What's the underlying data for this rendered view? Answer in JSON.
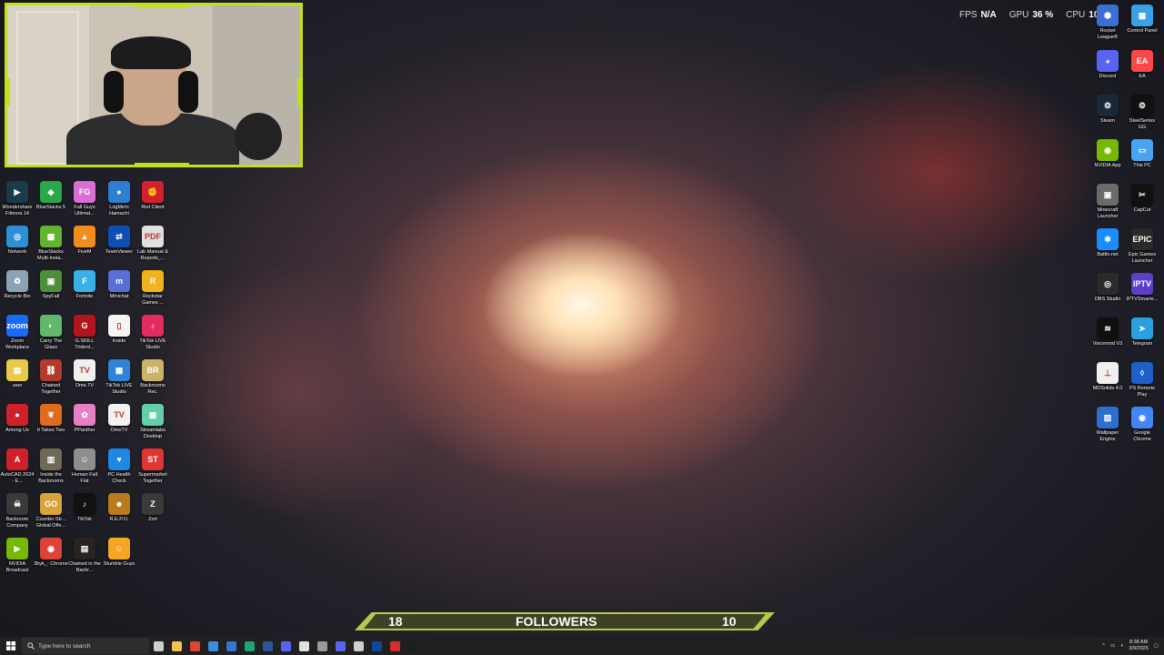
{
  "stats": {
    "fps_label": "FPS",
    "fps_value": "N/A",
    "gpu_label": "GPU",
    "gpu_value": "36 %",
    "cpu_label": "CPU",
    "cpu_value": "10"
  },
  "followers": {
    "label": "FOLLOWERS",
    "current": "18",
    "goal": "10"
  },
  "desktop_left": [
    {
      "label": "Wondershare Filmora 14",
      "color": "#1c3b4a",
      "glyph": "▶"
    },
    {
      "label": "BlueStacks 5",
      "color": "#2aa84a",
      "glyph": "◆"
    },
    {
      "label": "Fall Guys Ultimat...",
      "color": "#d86fd2",
      "glyph": "FG"
    },
    {
      "label": "LogMeIn Hamachi",
      "color": "#2f7fd0",
      "glyph": "●"
    },
    {
      "label": "Riot Client",
      "color": "#d4202e",
      "glyph": "✊"
    },
    {
      "label": "Network",
      "color": "#2e8fd6",
      "glyph": "◎"
    },
    {
      "label": "BlueStacks Multi-Insta...",
      "color": "#62b32e",
      "glyph": "▦"
    },
    {
      "label": "FiveM",
      "color": "#f28c1c",
      "glyph": "▲"
    },
    {
      "label": "TeamViewer",
      "color": "#0e4fb3",
      "glyph": "⇄"
    },
    {
      "label": "Lab Manual & Reports_...",
      "color": "#e0e0e0",
      "glyph": "PDF"
    },
    {
      "label": "Recycle Bin",
      "color": "#8aa3b5",
      "glyph": "♻"
    },
    {
      "label": "SpyFall",
      "color": "#4f8f3a",
      "glyph": "▣"
    },
    {
      "label": "Fortnite",
      "color": "#3ab0e8",
      "glyph": "F"
    },
    {
      "label": "Minichat",
      "color": "#5a6fd6",
      "glyph": "m"
    },
    {
      "label": "Rockstar Games ...",
      "color": "#f2b21c",
      "glyph": "R"
    },
    {
      "label": "Zoom Workplace",
      "color": "#1b6af5",
      "glyph": "zoom"
    },
    {
      "label": "Carry The Glass",
      "color": "#5fb86b",
      "glyph": "◐"
    },
    {
      "label": "G.SKILL Trident...",
      "color": "#b3151d",
      "glyph": "G"
    },
    {
      "label": "Inside",
      "color": "#f4f4f4",
      "glyph": "▯"
    },
    {
      "label": "TikTok LIVE Studio",
      "color": "#e22b5e",
      "glyph": "♪"
    },
    {
      "label": "user",
      "color": "#e9c94a",
      "glyph": "▤"
    },
    {
      "label": "Chained Together",
      "color": "#b23a2b",
      "glyph": "⛓"
    },
    {
      "label": "Ome.TV",
      "color": "#f0f0f0",
      "glyph": "TV"
    },
    {
      "label": "TikTok LIVE Studio",
      "color": "#2f84d8",
      "glyph": "▦"
    },
    {
      "label": "Backrooms Rec.",
      "color": "#c9b26a",
      "glyph": "BR"
    },
    {
      "label": "Among Us",
      "color": "#d0202a",
      "glyph": "●"
    },
    {
      "label": "It Takes Two",
      "color": "#e26a1e",
      "glyph": "❦"
    },
    {
      "label": "PPanther",
      "color": "#e77fc4",
      "glyph": "✿"
    },
    {
      "label": "OmeTV",
      "color": "#f2f2f2",
      "glyph": "TV"
    },
    {
      "label": "Streamlabs Desktop",
      "color": "#62cfa8",
      "glyph": "▣"
    },
    {
      "label": "AutoCAD 2024 - E...",
      "color": "#d0202a",
      "glyph": "A"
    },
    {
      "label": "Inside the Backrooms",
      "color": "#6e6a55",
      "glyph": "▥"
    },
    {
      "label": "Human Fall Flat",
      "color": "#8e8e8e",
      "glyph": "☺"
    },
    {
      "label": "PC Health Check",
      "color": "#1e88e5",
      "glyph": "♥"
    },
    {
      "label": "Supermarket Together",
      "color": "#e03535",
      "glyph": "ST"
    },
    {
      "label": "Backroom Company",
      "color": "#3a3a3a",
      "glyph": "☠"
    },
    {
      "label": "Counter-Str... Global Offe...",
      "color": "#d9a23a",
      "glyph": "GO"
    },
    {
      "label": "TikTok",
      "color": "#111111",
      "glyph": "♪"
    },
    {
      "label": "R.E.P.O.",
      "color": "#b97c1a",
      "glyph": "☻"
    },
    {
      "label": "Zort",
      "color": "#3a3a3a",
      "glyph": "Z"
    },
    {
      "label": "NVIDIA Broadcast",
      "color": "#76b900",
      "glyph": "▶"
    },
    {
      "label": "3byk_- Chrome",
      "color": "#db4437",
      "glyph": "◉"
    },
    {
      "label": "Chained in the Backr...",
      "color": "#2a2320",
      "glyph": "▤"
    },
    {
      "label": "Stumble Guys",
      "color": "#f5a623",
      "glyph": "☺"
    }
  ],
  "desktop_right": [
    {
      "label": "Rocket League®",
      "color": "#3c6fd6",
      "glyph": "⬢"
    },
    {
      "label": "Control Panel",
      "color": "#3aa0e8",
      "glyph": "▦"
    },
    {
      "label": "Discord",
      "color": "#5865f2",
      "glyph": "◕"
    },
    {
      "label": "EA",
      "color": "#ff4747",
      "glyph": "EA"
    },
    {
      "label": "Steam",
      "color": "#1b2838",
      "glyph": "⚙"
    },
    {
      "label": "SteelSeries GG",
      "color": "#111111",
      "glyph": "⚙"
    },
    {
      "label": "NVIDIA App",
      "color": "#76b900",
      "glyph": "◉"
    },
    {
      "label": "This PC",
      "color": "#4aa3f0",
      "glyph": "▭"
    },
    {
      "label": "Minecraft Launcher",
      "color": "#6b6b6b",
      "glyph": "▣"
    },
    {
      "label": "CapCut",
      "color": "#111111",
      "glyph": "✂"
    },
    {
      "label": "Battle.net",
      "color": "#1a8cff",
      "glyph": "✱"
    },
    {
      "label": "Epic Games Launcher",
      "color": "#2a2a2a",
      "glyph": "EPIC"
    },
    {
      "label": "OBS Studio",
      "color": "#2b2b2b",
      "glyph": "◎"
    },
    {
      "label": "IPTVSmarte...",
      "color": "#5b3fc9",
      "glyph": "IPTV"
    },
    {
      "label": "Voicemod V3",
      "color": "#101010",
      "glyph": "≋"
    },
    {
      "label": "Telegram",
      "color": "#2aa0e0",
      "glyph": "➤"
    },
    {
      "label": "MDSolids 4.0",
      "color": "#f0f0f0",
      "glyph": "⊥"
    },
    {
      "label": "PS Remote Play",
      "color": "#1f5fc9",
      "glyph": "◊"
    },
    {
      "label": "Wallpaper Engine",
      "color": "#2d6fd0",
      "glyph": "▧"
    },
    {
      "label": "Google Chrome",
      "color": "#4285f4",
      "glyph": "◉"
    }
  ],
  "taskbar": {
    "search_placeholder": "Type here to search",
    "apps": [
      {
        "name": "task-view-icon",
        "color": "#cfcfcf"
      },
      {
        "name": "file-explorer-icon",
        "color": "#f2c14e"
      },
      {
        "name": "chrome-icon",
        "color": "#db4437"
      },
      {
        "name": "store-icon",
        "color": "#3a8de0"
      },
      {
        "name": "mail-icon",
        "color": "#2f7ad0"
      },
      {
        "name": "edge-icon",
        "color": "#1fa37a"
      },
      {
        "name": "word-icon",
        "color": "#2b5797"
      },
      {
        "name": "discord-icon",
        "color": "#5865f2"
      },
      {
        "name": "chrome-profile-icon",
        "color": "#e0e0e0"
      },
      {
        "name": "settings-icon",
        "color": "#9a9a9a"
      },
      {
        "name": "discord2-icon",
        "color": "#5865f2"
      },
      {
        "name": "steelseries-icon",
        "color": "#cfcfcf"
      },
      {
        "name": "app-icon",
        "color": "#0d47a1"
      },
      {
        "name": "riot-icon",
        "color": "#d32f2f"
      },
      {
        "name": "terminal-icon",
        "color": "#1e1e1e"
      }
    ],
    "time": "8:38 AM",
    "date": "3/9/2025"
  }
}
